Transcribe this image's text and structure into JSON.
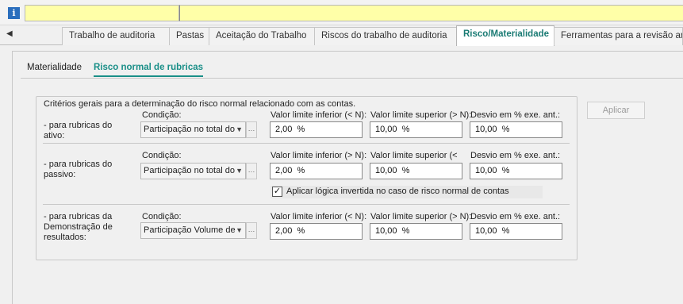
{
  "infobar": {
    "message": "",
    "message2": ""
  },
  "tabs": [
    {
      "label": "Trabalho de auditoria",
      "active": false
    },
    {
      "label": "Pastas",
      "active": false
    },
    {
      "label": "Aceitação do Trabalho",
      "active": false
    },
    {
      "label": "Riscos do trabalho de auditoria",
      "active": false
    },
    {
      "label": "Risco/Materialidade",
      "active": true
    },
    {
      "label": "Ferramentas para a revisão an",
      "active": false
    }
  ],
  "subtabs": [
    {
      "label": "Materialidade",
      "active": false
    },
    {
      "label": "Risco normal de rubricas",
      "active": true
    }
  ],
  "group": {
    "title": "Critérios gerais para a determinação do risco normal relacionado com as contas.",
    "rows": [
      {
        "label": "- para rubricas do ativo:",
        "condition_label": "Condição:",
        "condition_value": "Participação no total do",
        "lower_label": "Valor limite inferior (< N):",
        "lower_value": "2,00  %",
        "upper_label": "Valor limite superior (> N):",
        "upper_value": "10,00  %",
        "dev_label": "Desvio em % exe. ant.:",
        "dev_value": "10,00  %"
      },
      {
        "label": "- para rubricas do passivo:",
        "condition_label": "Condição:",
        "condition_value": "Participação no total do",
        "lower_label": "Valor limite inferior (> N):",
        "lower_value": "2,00  %",
        "upper_label": "Valor limite superior (<",
        "upper_value": "10,00  %",
        "dev_label": "Desvio em % exe. ant.:",
        "dev_value": "10,00  %",
        "checkbox_label": "Aplicar lógica invertida no caso de risco normal de contas",
        "checkbox_checked": true
      },
      {
        "label": "- para rubricas da Demonstração de resultados:",
        "condition_label": "Condição:",
        "condition_value": "Participação Volume de",
        "lower_label": "Valor limite inferior (< N):",
        "lower_value": "2,00  %",
        "upper_label": "Valor limite superior (> N):",
        "upper_value": "10,00  %",
        "dev_label": "Desvio em % exe. ant.:",
        "dev_value": "10,00  %"
      }
    ]
  },
  "apply_button": {
    "label": "Aplicar",
    "enabled": false
  },
  "icons": {
    "info": "info-icon",
    "tab_scroll_left": "chevron-left-icon",
    "dropdown": "chevron-down-icon"
  },
  "colors": {
    "accent": "#1a8f88",
    "message_bg": "#ffffa8",
    "info_icon": "#2a6ebd"
  }
}
